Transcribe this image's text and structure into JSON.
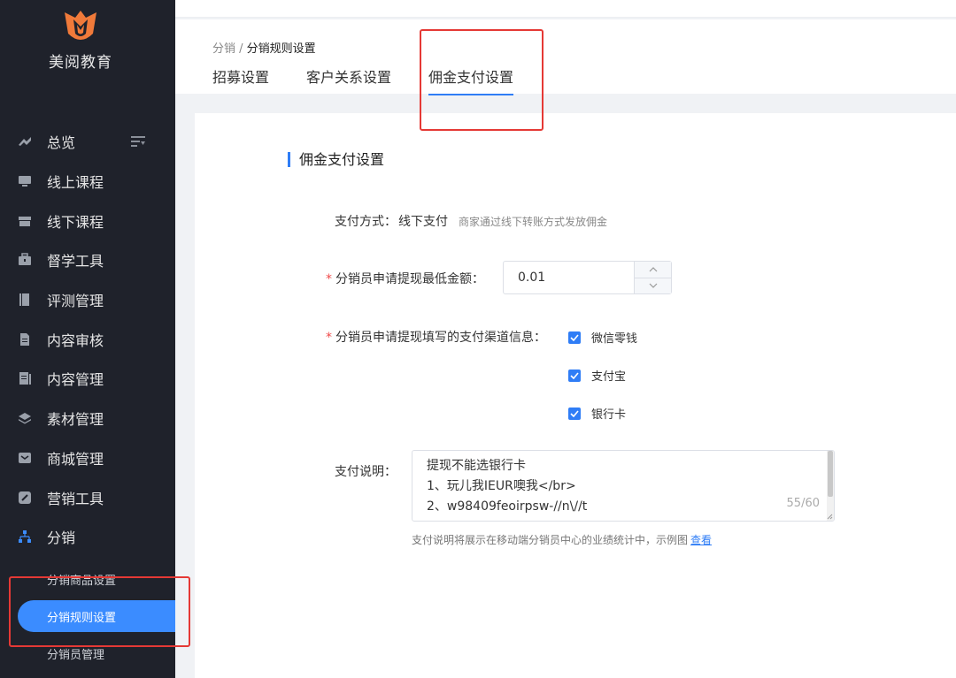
{
  "brand": {
    "name": "美阅教育",
    "logo_color": "#f07a3a"
  },
  "sidebar": {
    "items": [
      {
        "label": "总览",
        "icon": "overview-icon"
      },
      {
        "label": "线上课程",
        "icon": "monitor-icon"
      },
      {
        "label": "线下课程",
        "icon": "store-icon"
      },
      {
        "label": "督学工具",
        "icon": "briefcase-icon"
      },
      {
        "label": "评测管理",
        "icon": "book-icon"
      },
      {
        "label": "内容审核",
        "icon": "document-icon"
      },
      {
        "label": "内容管理",
        "icon": "content-icon"
      },
      {
        "label": "素材管理",
        "icon": "layers-icon"
      },
      {
        "label": "商城管理",
        "icon": "mail-icon"
      },
      {
        "label": "营销工具",
        "icon": "tag-icon"
      },
      {
        "label": "分销",
        "icon": "distribution-icon"
      }
    ],
    "submenu": [
      {
        "label": "分销商品设置"
      },
      {
        "label": "分销规则设置",
        "active": true
      },
      {
        "label": "分销员管理"
      }
    ],
    "active_color": "#3b8cff"
  },
  "header": {
    "breadcrumb": {
      "root": "分销",
      "separator": " / ",
      "current": "分销规则设置"
    },
    "tabs": [
      {
        "label": "招募设置"
      },
      {
        "label": "客户关系设置"
      },
      {
        "label": "佣金支付设置",
        "active": true
      }
    ]
  },
  "form": {
    "section_title": "佣金支付设置",
    "pay_method": {
      "label": "支付方式：",
      "value": "线下支付",
      "hint": "商家通过线下转账方式发放佣金"
    },
    "min_amount": {
      "required": "*",
      "label": "分销员申请提现最低金额：",
      "value": "0.01"
    },
    "channels": {
      "required": "*",
      "label": "分销员申请提现填写的支付渠道信息：",
      "options": [
        {
          "label": "微信零钱",
          "checked": true
        },
        {
          "label": "支付宝",
          "checked": true
        },
        {
          "label": "银行卡",
          "checked": true
        }
      ]
    },
    "description": {
      "label": "支付说明：",
      "lines": [
        "提现不能选银行卡",
        "1、玩儿我IEUR噢我</br>",
        "2、w98409feoirpsw-//n\\//t"
      ],
      "counter": "55/60",
      "help": "支付说明将展示在移动端分销员中心的业绩统计中，示例图",
      "help_link": "查看"
    }
  },
  "colors": {
    "accent": "#2f7df6",
    "highlight": "#e53935",
    "required": "#f04a4a"
  }
}
